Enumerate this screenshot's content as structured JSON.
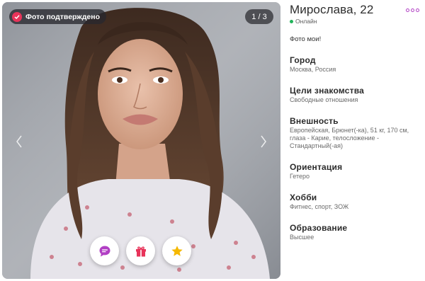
{
  "photo": {
    "verified_label": "Фото подтверждено",
    "counter": "1 / 3",
    "prev_icon": "chevron-left-icon",
    "next_icon": "chevron-right-icon"
  },
  "actions": [
    {
      "name": "message",
      "icon": "chat-bubble-icon",
      "color": "#b13fc4"
    },
    {
      "name": "gift",
      "icon": "gift-icon",
      "color": "#e8345a"
    },
    {
      "name": "favorite",
      "icon": "star-icon",
      "color": "#f5b800"
    }
  ],
  "profile": {
    "name": "Мирослава, 22",
    "status": "Онлайн",
    "about": "Фото мои!",
    "sections": [
      {
        "title": "Город",
        "value": "Москва, Россия"
      },
      {
        "title": "Цели знакомства",
        "value": "Свободные отношения"
      },
      {
        "title": "Внешность",
        "value": "Европейская, Брюнет(-ка), 51 кг, 170 см, глаза - Карие, телосложение - Стандартный(-ая)"
      },
      {
        "title": "Ориентация",
        "value": "Гетеро"
      },
      {
        "title": "Хобби",
        "value": "Фитнес, спорт, ЗОЖ"
      },
      {
        "title": "Образование",
        "value": "Высшее"
      }
    ]
  },
  "colors": {
    "accent": "#b13fc4",
    "online": "#22b35a",
    "verified": "#e8345a"
  }
}
